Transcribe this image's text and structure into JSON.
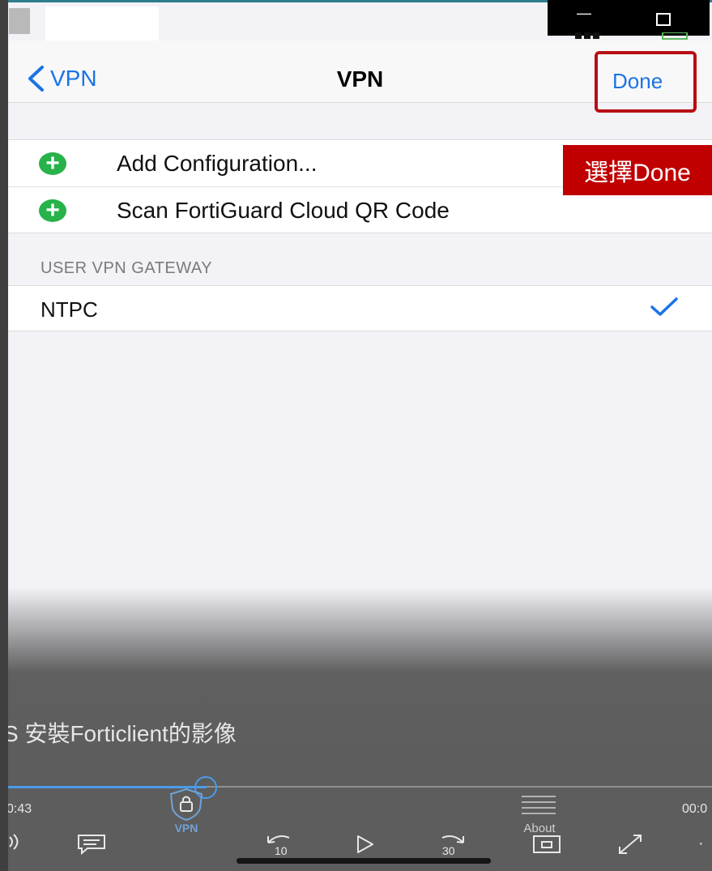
{
  "window": {
    "minimize_label": "—"
  },
  "navbar": {
    "back_label": "VPN",
    "title": "VPN",
    "done_label": "Done"
  },
  "annotation": {
    "tooltip": "選擇Done",
    "highlight_color": "#b80f14"
  },
  "config_list": {
    "items": [
      {
        "label": "Add Configuration...",
        "icon": "plus-circle-icon"
      },
      {
        "label": "Scan FortiGuard Cloud QR Code",
        "icon": "plus-circle-icon"
      }
    ]
  },
  "gateway_section": {
    "header": "USER VPN GATEWAY",
    "items": [
      {
        "label": "NTPC",
        "selected": true
      }
    ]
  },
  "player": {
    "title": "S 安裝Forticlient的影像",
    "time_elapsed": "0:43",
    "time_total": "00:0",
    "progress_percent": 28,
    "vpn_label": "VPN",
    "about_label": "About",
    "rewind_label": "10",
    "forward_label": "30"
  },
  "colors": {
    "accent": "#1a73e8",
    "plus_green": "#27b24a",
    "player_progress": "#4a9be8"
  }
}
